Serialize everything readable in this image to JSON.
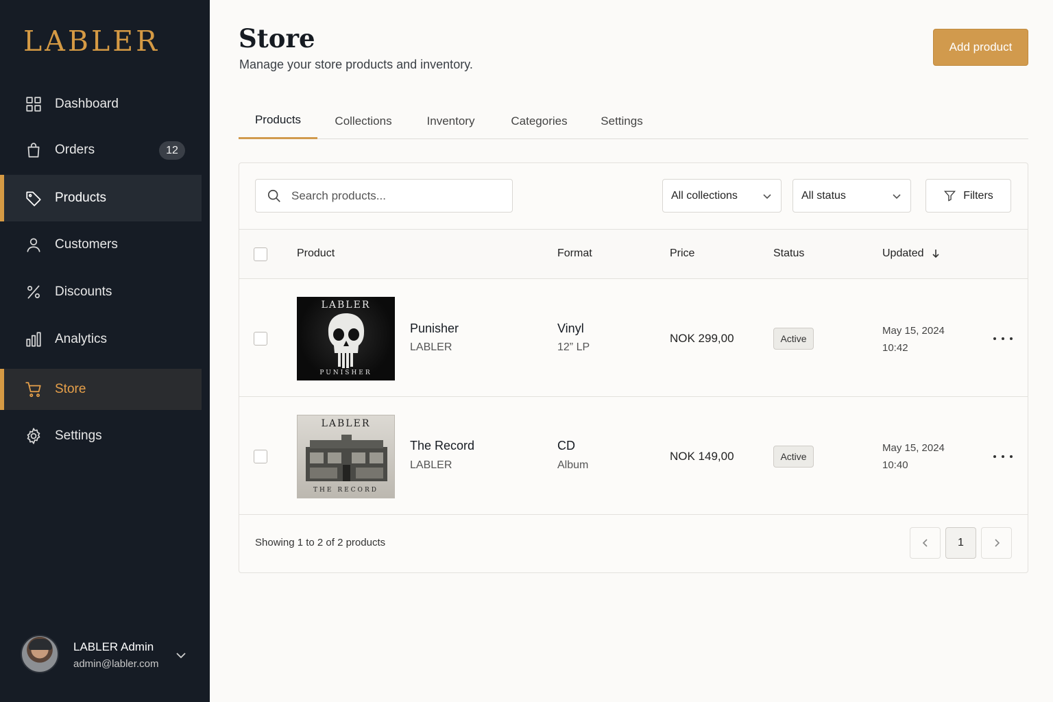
{
  "brand": "LABLER",
  "sidebar": {
    "items": [
      {
        "label": "Dashboard",
        "icon": "grid-icon"
      },
      {
        "label": "Orders",
        "icon": "bag-icon",
        "badge": "12"
      },
      {
        "label": "Products",
        "icon": "tag-icon"
      },
      {
        "label": "Customers",
        "icon": "user-icon"
      },
      {
        "label": "Discounts",
        "icon": "percent-icon"
      },
      {
        "label": "Analytics",
        "icon": "bar-chart-icon"
      },
      {
        "label": "Store",
        "icon": "cart-icon"
      },
      {
        "label": "Settings",
        "icon": "gear-icon"
      }
    ],
    "user": {
      "name": "LABLER Admin",
      "email": "admin@labler.com"
    }
  },
  "header": {
    "title": "Store",
    "subtitle": "Manage your store products and inventory.",
    "add_button": "Add product"
  },
  "tabs": [
    "Products",
    "Collections",
    "Inventory",
    "Categories",
    "Settings"
  ],
  "toolbar": {
    "search_placeholder": "Search products...",
    "collections_select": "All collections",
    "status_select": "All status",
    "filters_label": "Filters"
  },
  "table": {
    "columns": [
      "Product",
      "Format",
      "Price",
      "Status",
      "Updated"
    ],
    "rows": [
      {
        "name": "Punisher",
        "vendor": "LABLER",
        "format": "Vinyl",
        "format_detail": "12” LP",
        "price": "NOK 299,00",
        "status": "Active",
        "date": "May 15, 2024",
        "time": "10:42",
        "cover_brand": "LABLER",
        "cover_title": "PUNISHER"
      },
      {
        "name": "The Record",
        "vendor": "LABLER",
        "format": "CD",
        "format_detail": "Album",
        "price": "NOK 149,00",
        "status": "Active",
        "date": "May 15, 2024",
        "time": "10:40",
        "cover_brand": "LABLER",
        "cover_title": "THE RECORD"
      }
    ]
  },
  "footer": {
    "showing": "Showing 1 to 2 of 2 products",
    "current_page": "1"
  },
  "colors": {
    "accent": "#d19a4d",
    "sidebar_bg": "#161c25",
    "page_bg": "#fbfaf8"
  }
}
